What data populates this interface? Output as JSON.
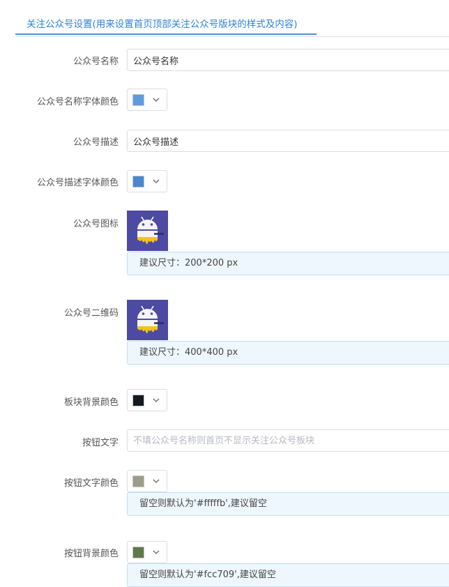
{
  "tab": {
    "label": "关注公众号设置(用来设置首页顶部关注公众号版块的样式及内容)"
  },
  "fields": {
    "name": {
      "label": "公众号名称",
      "value": "公众号名称"
    },
    "name_color": {
      "label": "公众号名称字体颜色",
      "color": "#5b9bde"
    },
    "desc": {
      "label": "公众号描述",
      "value": "公众号描述"
    },
    "desc_color": {
      "label": "公众号描述字体颜色",
      "color": "#4a87cc"
    },
    "icon": {
      "label": "公众号图标",
      "hint": "建议尺寸：200*200 px"
    },
    "qrcode": {
      "label": "公众号二维码",
      "hint": "建议尺寸：400*400 px"
    },
    "bg_color": {
      "label": "板块背景颜色",
      "color": "#141a22"
    },
    "btn_text": {
      "label": "按钮文字",
      "value": "",
      "placeholder": "不填公众号名称则首页不显示关注公众号板块"
    },
    "btn_text_color": {
      "label": "按钮文字颜色",
      "color": "#9c9c88",
      "hint": "留空则默认为'#fffffb',建议留空"
    },
    "btn_bg_color": {
      "label": "按钮背景颜色",
      "color": "#5e7a4a",
      "hint": "留空则默认为'#fcc709',建议留空"
    }
  }
}
